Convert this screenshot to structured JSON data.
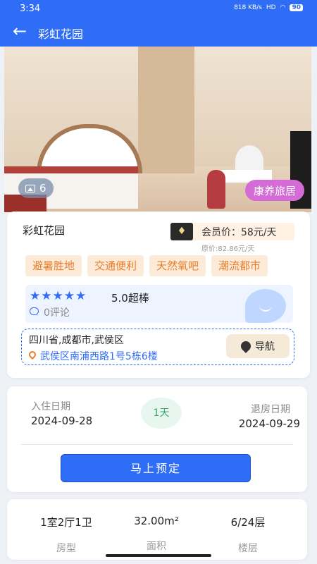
{
  "status_bar": {
    "time": "3:34",
    "network": "818 KB/s",
    "signal": "HD",
    "battery": "90"
  },
  "header": {
    "back_icon": "arrow-left-icon",
    "title": "彩虹花园"
  },
  "gallery": {
    "photo_count": "6",
    "tag": "康养旅居"
  },
  "hotel": {
    "name": "彩虹花园",
    "member_price": "会员价：58元/天",
    "original_price": "原价:82.86元/天",
    "tags": [
      "避暑胜地",
      "交通便利",
      "天然氧吧",
      "潮流都市"
    ],
    "stars": 5,
    "stars_text": "★★★★★",
    "rating": "5.0超棒",
    "comments": "0评论",
    "address_region": "四川省,成都市,武侯区",
    "address_detail": "武侯区南浦西路1号5栋6楼",
    "nav_label": "导航"
  },
  "booking": {
    "checkin_label": "入住日期",
    "checkin_date": "2024-09-28",
    "days": "1天",
    "checkout_label": "退房日期",
    "checkout_date": "2024-09-29",
    "book_button": "马上预定"
  },
  "room": {
    "layout_value": "1室2厅1卫",
    "layout_label": "房型",
    "area_value": "32.00m²",
    "area_label": "面积",
    "floor_value": "6/24层",
    "floor_label": "楼层"
  },
  "colors": {
    "primary": "#2f6df6",
    "accent": "#ea7d2b",
    "tag_pink": "#d46bd6",
    "green": "#3ba86c"
  }
}
